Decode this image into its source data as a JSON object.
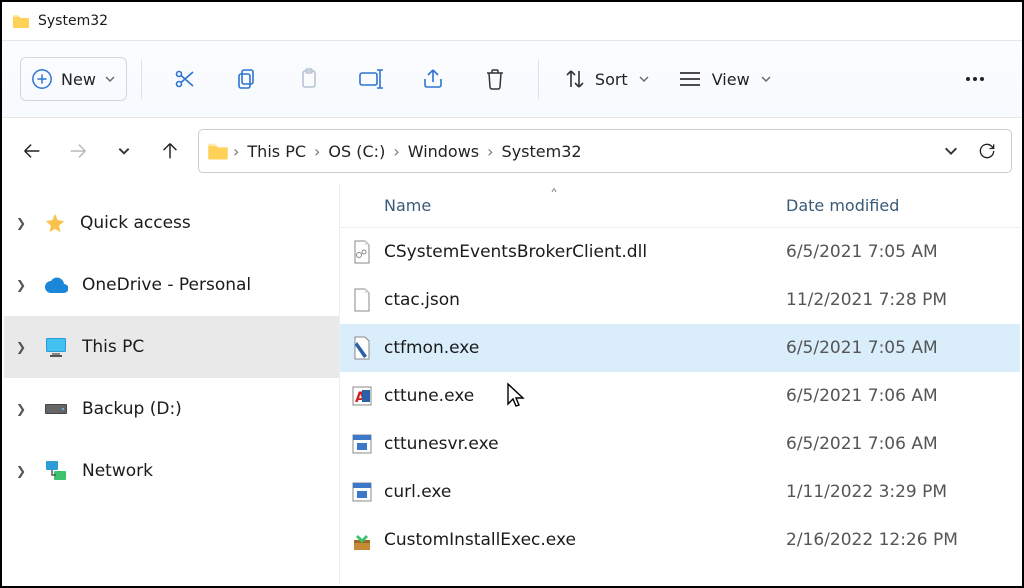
{
  "title": "System32",
  "toolbar": {
    "new_label": "New",
    "sort_label": "Sort",
    "view_label": "View"
  },
  "breadcrumb": [
    "This PC",
    "OS (C:)",
    "Windows",
    "System32"
  ],
  "columns": {
    "name": "Name",
    "date": "Date modified"
  },
  "nav": {
    "quick": "Quick access",
    "onedrive": "OneDrive - Personal",
    "thispc": "This PC",
    "backup": "Backup (D:)",
    "network": "Network"
  },
  "files": [
    {
      "name": "CSystemEventsBrokerClient.dll",
      "date": "6/5/2021 7:05 AM",
      "icon": "dll"
    },
    {
      "name": "ctac.json",
      "date": "11/2/2021 7:28 PM",
      "icon": "file"
    },
    {
      "name": "ctfmon.exe",
      "date": "6/5/2021 7:05 AM",
      "icon": "exe",
      "selected": true
    },
    {
      "name": "cttune.exe",
      "date": "6/5/2021 7:06 AM",
      "icon": "exe2"
    },
    {
      "name": "cttunesvr.exe",
      "date": "6/5/2021 7:06 AM",
      "icon": "exe3"
    },
    {
      "name": "curl.exe",
      "date": "1/11/2022 3:29 PM",
      "icon": "exe3"
    },
    {
      "name": "CustomInstallExec.exe",
      "date": "2/16/2022 12:26 PM",
      "icon": "installer"
    }
  ]
}
